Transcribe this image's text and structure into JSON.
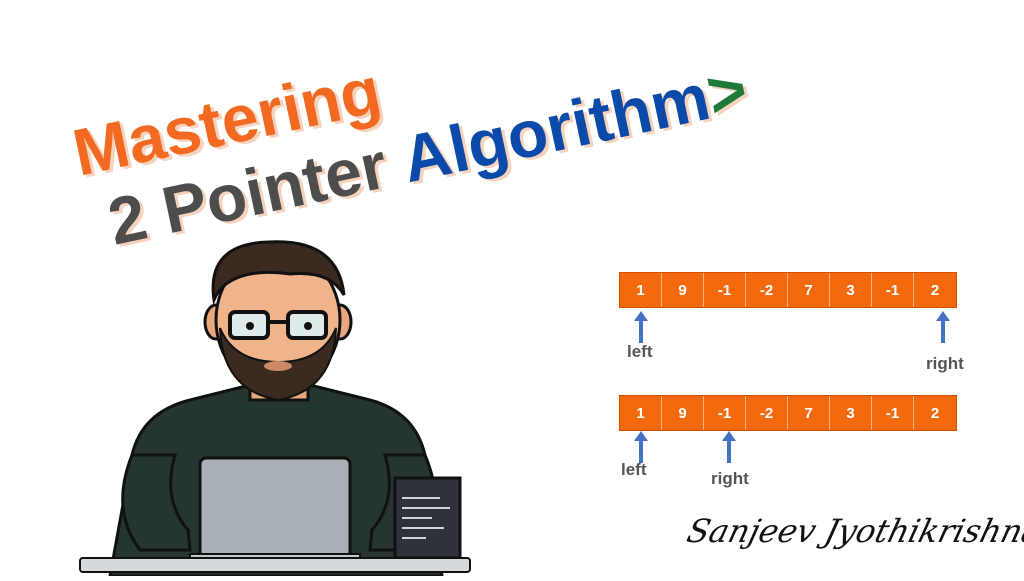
{
  "title": {
    "line1": "Mastering",
    "line2_part1": "2 Pointer",
    "line2_part2": "Algorithm",
    "line2_arrow": ">"
  },
  "colors": {
    "orange": "#f26a21",
    "gray": "#4d4d4d",
    "blue": "#0b4aa8",
    "green": "#1f7a3a",
    "cell": "#f26a0d",
    "pointer": "#4472c4"
  },
  "array": [
    "1",
    "9",
    "-1",
    "-2",
    "7",
    "3",
    "-1",
    "2"
  ],
  "diagram": {
    "row1": {
      "left_label": "left",
      "right_label": "right",
      "left_index": 0,
      "right_index": 7
    },
    "row2": {
      "left_label": "left",
      "right_label": "right",
      "left_index": 0,
      "right_index": 2
    }
  },
  "illustration": {
    "name": "developer-at-laptop"
  },
  "signature": "Sanjeev Jyothikrishnan"
}
